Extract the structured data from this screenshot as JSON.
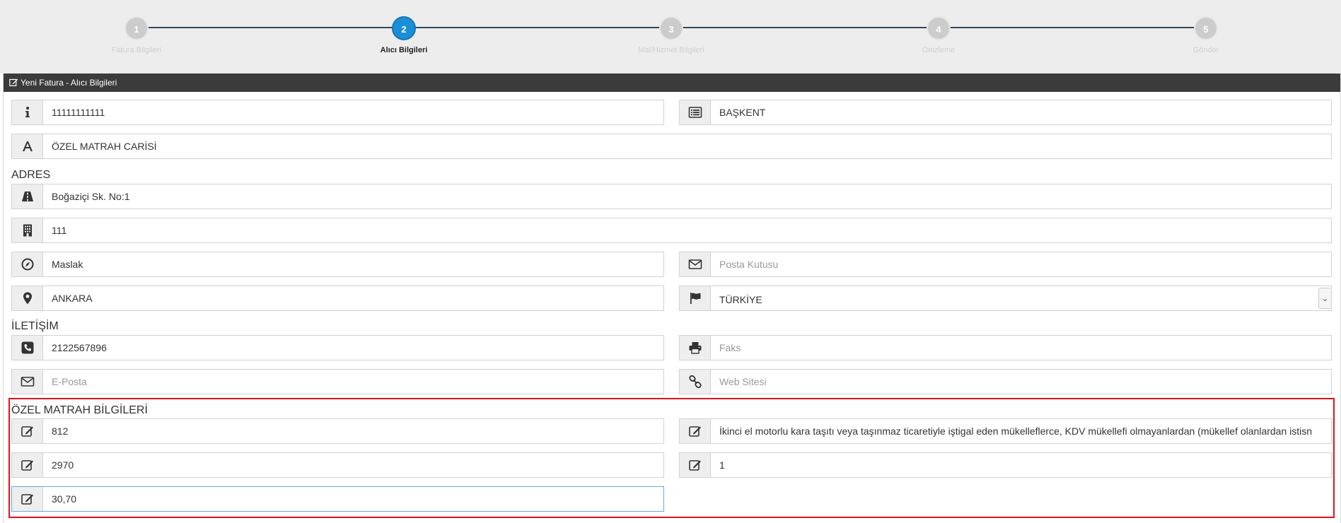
{
  "stepper": {
    "steps": [
      {
        "num": "1",
        "label": "Fatura Bilgileri"
      },
      {
        "num": "2",
        "label": "Alıcı Bilgileri"
      },
      {
        "num": "3",
        "label": "Mal/Hizmet Bilgileri"
      },
      {
        "num": "4",
        "label": "Önizleme"
      },
      {
        "num": "5",
        "label": "Gönder"
      }
    ]
  },
  "panel": {
    "title": "Yeni Fatura - Alıcı Bilgileri"
  },
  "fields": {
    "tax_id": "11111111111",
    "tax_office": "BAŞKENT",
    "title": "ÖZEL MATRAH CARİSİ",
    "street": "Boğaziçi Sk. No:1",
    "building_no": "111",
    "district": "Maslak",
    "po_box_placeholder": "Posta Kutusu",
    "city": "ANKARA",
    "country": "TÜRKİYE",
    "phone": "2122567896",
    "fax_placeholder": "Faks",
    "email_placeholder": "E-Posta",
    "website_placeholder": "Web Sitesi",
    "special_code": "812",
    "special_desc": "İkinci el motorlu kara taşıtı veya taşınmaz ticaretiyle iştigal eden mükelleflerce, KDV mükellefi olmayanlardan (mükellef olanlardan istisn",
    "special_amount": "2970",
    "special_qty": "1",
    "special_rate": "30,70"
  },
  "sections": {
    "address": "ADRES",
    "contact": "İLETİŞİM",
    "special": "ÖZEL MATRAH BİLGİLERİ"
  },
  "colors": {
    "active_step": "#1a8fd8",
    "highlight": "#e3121b",
    "panel_header": "#3b3b3b"
  }
}
